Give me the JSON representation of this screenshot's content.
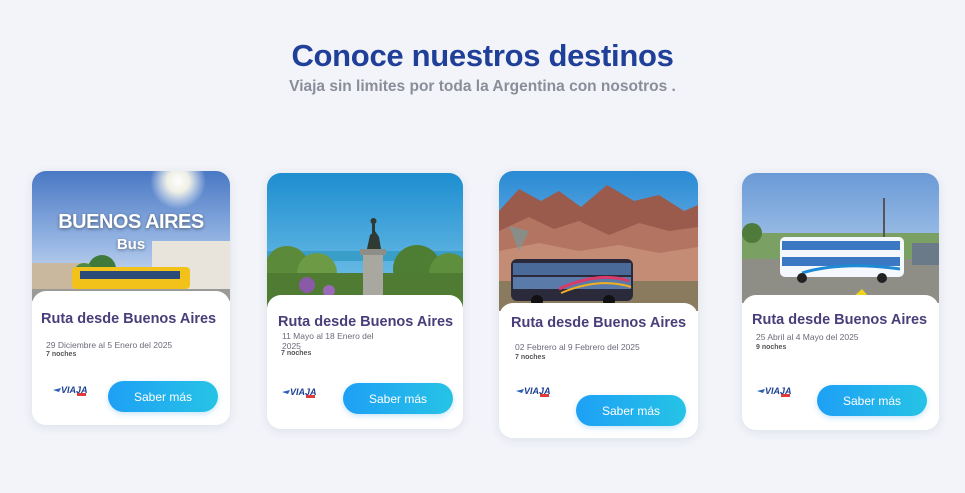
{
  "header": {
    "title": "Conoce nuestros destinos",
    "subtitle": "Viaja sin limites por toda la Argentina con nosotros ."
  },
  "cards": [
    {
      "title": "Ruta desde Buenos Aires",
      "dates": "29 Diciembre al 5 Enero del 2025",
      "nights": "7 noches",
      "button": "Saber más",
      "logo_text": "VIAJA",
      "image_text_main": "BUENOS AIRES",
      "image_text_sub": "Bus"
    },
    {
      "title": "Ruta desde Buenos Aires",
      "dates": "11 Mayo al 18 Enero del 2025",
      "nights": "7 noches",
      "button": "Saber más",
      "logo_text": "VIAJA"
    },
    {
      "title": "Ruta desde Buenos Aires",
      "dates": "02 Febrero al 9 Febrero del 2025",
      "nights": "7 noches",
      "button": "Saber más",
      "logo_text": "VIAJA"
    },
    {
      "title": "Ruta desde Buenos Aires",
      "dates": "25 Abril al 4 Mayo del 2025",
      "nights": "9 noches",
      "button": "Saber más",
      "logo_text": "VIAJA"
    }
  ]
}
